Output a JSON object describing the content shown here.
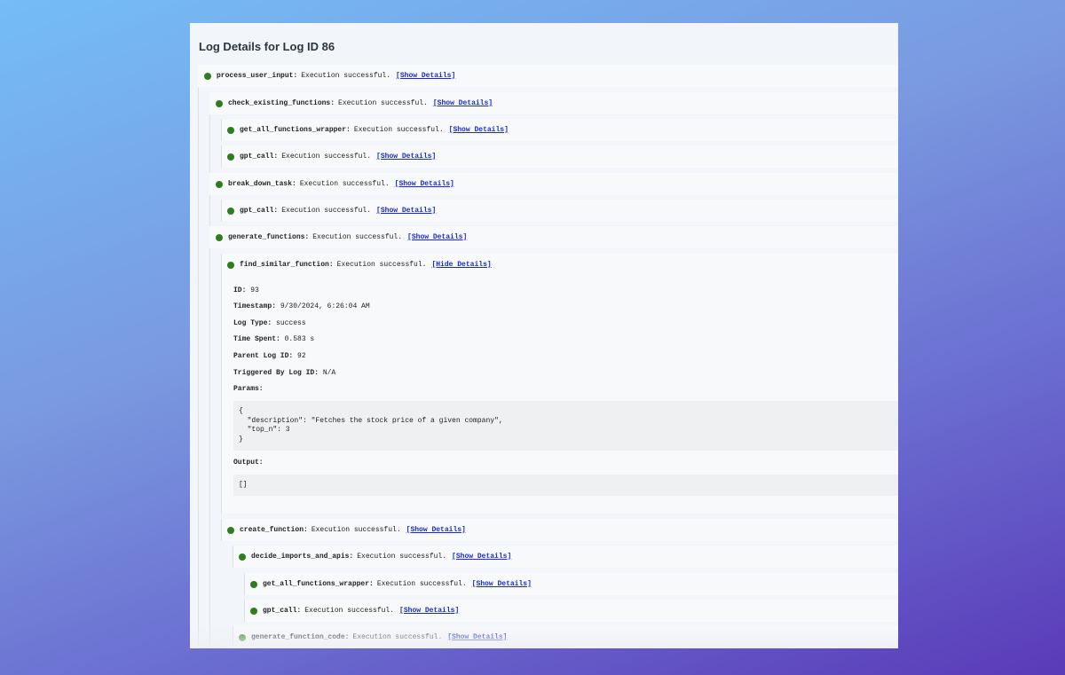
{
  "title": "Log Details for Log ID 86",
  "status_color": "#2e7d1e",
  "rows": [
    {
      "fn": "process_user_input:",
      "msg": "Execution successful.",
      "link": "[Show Details]"
    },
    {
      "fn": "check_existing_functions:",
      "msg": "Execution successful.",
      "link": "[Show Details]"
    },
    {
      "fn": "get_all_functions_wrapper:",
      "msg": "Execution successful.",
      "link": "[Show Details]"
    },
    {
      "fn": "gpt_call:",
      "msg": "Execution successful.",
      "link": "[Show Details]"
    },
    {
      "fn": "break_down_task:",
      "msg": "Execution successful.",
      "link": "[Show Details]"
    },
    {
      "fn": "gpt_call:",
      "msg": "Execution successful.",
      "link": "[Show Details]"
    },
    {
      "fn": "generate_functions:",
      "msg": "Execution successful.",
      "link": "[Show Details]"
    },
    {
      "fn": "find_similar_function:",
      "msg": "Execution successful.",
      "link": "[Hide Details]"
    },
    {
      "fn": "create_function:",
      "msg": "Execution successful.",
      "link": "[Show Details]"
    },
    {
      "fn": "decide_imports_and_apis:",
      "msg": "Execution successful.",
      "link": "[Show Details]"
    },
    {
      "fn": "get_all_functions_wrapper:",
      "msg": "Execution successful.",
      "link": "[Show Details]"
    },
    {
      "fn": "gpt_call:",
      "msg": "Execution successful.",
      "link": "[Show Details]"
    },
    {
      "fn": "generate_function_code:",
      "msg": "Execution successful.",
      "link": "[Show Details]"
    }
  ],
  "details": {
    "id_label": "ID:",
    "id_value": "93",
    "timestamp_label": "Timestamp:",
    "timestamp_value": "9/30/2024, 6:26:04 AM",
    "logtype_label": "Log Type:",
    "logtype_value": "success",
    "time_label": "Time Spent:",
    "time_value": "0.583 s",
    "parent_label": "Parent Log ID:",
    "parent_value": "92",
    "triggered_label": "Triggered By Log ID:",
    "triggered_value": "N/A",
    "params_label": "Params:",
    "params_value": "{\n  \"description\": \"Fetches the stock price of a given company\",\n  \"top_n\": 3\n}",
    "output_label": "Output:",
    "output_value": "[]"
  }
}
